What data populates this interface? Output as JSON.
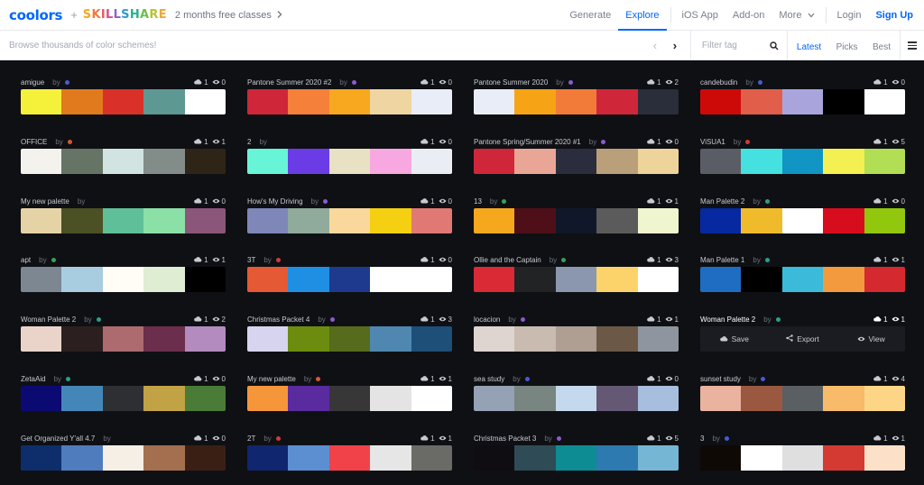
{
  "header": {
    "logo": "coolors",
    "plus": "+",
    "partner_parts": [
      {
        "text": "S",
        "color": "#f6a821"
      },
      {
        "text": "K",
        "color": "#f07b3f"
      },
      {
        "text": "I",
        "color": "#e85b5b"
      },
      {
        "text": "L",
        "color": "#d34f8a"
      },
      {
        "text": "L",
        "color": "#8a63c9"
      },
      {
        "text": "S",
        "color": "#2f9ad0"
      },
      {
        "text": "H",
        "color": "#23b38a"
      },
      {
        "text": "A",
        "color": "#6cbf45"
      },
      {
        "text": "R",
        "color": "#b7c330"
      },
      {
        "text": "E",
        "color": "#f0a73a"
      }
    ],
    "promo": "2 months free classes",
    "nav": {
      "generate": "Generate",
      "explore": "Explore",
      "ios": "iOS App",
      "addon": "Add-on",
      "more": "More",
      "login": "Login",
      "signup": "Sign Up"
    }
  },
  "search": {
    "placeholder": "Browse thousands of color schemes!",
    "filter_placeholder": "Filter tag",
    "tabs": [
      "Latest",
      "Picks",
      "Best"
    ],
    "active_tab": "Latest"
  },
  "colors": {
    "accent": "#0066ff",
    "background": "#0f1014"
  },
  "overlay": {
    "save": "Save",
    "export": "Export",
    "view": "View"
  },
  "palettes": [
    {
      "name": "amigue",
      "by": "by",
      "dot": "#4a5ad0",
      "saves": "1",
      "views": "0",
      "colors": [
        "#f5f03a",
        "#e17a1d",
        "#d9302a",
        "#5d9893",
        "#ffffff"
      ]
    },
    {
      "name": "Pantone Summer 2020 #2",
      "by": "by",
      "dot": "#8a5bd0",
      "saves": "1",
      "views": "0",
      "colors": [
        "#d0263a",
        "#f5803a",
        "#f8a81e",
        "#efd5a1",
        "#e8edf8"
      ]
    },
    {
      "name": "Pantone Summer 2020",
      "by": "by",
      "dot": "#8a5bd0",
      "saves": "1",
      "views": "2",
      "colors": [
        "#e8edf8",
        "#f7a316",
        "#f37b39",
        "#d0263a",
        "#2a2d3a"
      ]
    },
    {
      "name": "candebudin",
      "by": "by",
      "dot": "#4a5ad0",
      "saves": "1",
      "views": "0",
      "colors": [
        "#cd0a08",
        "#e05e4a",
        "#a9a5dc",
        "#000000",
        "#ffffff"
      ]
    },
    {
      "name": "OFFICE",
      "by": "by",
      "dot": "#d05a3a",
      "saves": "1",
      "views": "1",
      "colors": [
        "#f4f2ec",
        "#667466",
        "#d1e4e2",
        "#828c88",
        "#2f2516"
      ]
    },
    {
      "name": "2",
      "by": "by",
      "dot": "",
      "saves": "1",
      "views": "0",
      "colors": [
        "#68f5d7",
        "#6b3ce6",
        "#e8e1c4",
        "#f7a8e0",
        "#eaeef4"
      ]
    },
    {
      "name": "Pantone Spring/Summer 2020 #1",
      "by": "by",
      "dot": "#8a5bd0",
      "saves": "1",
      "views": "0",
      "colors": [
        "#d0263a",
        "#e9a697",
        "#2b2d3c",
        "#b99f7a",
        "#eed39b"
      ]
    },
    {
      "name": "ViSUA1",
      "by": "by",
      "dot": "#d03a3a",
      "saves": "1",
      "views": "5",
      "colors": [
        "#5b5d66",
        "#45e0e0",
        "#1095c5",
        "#f5f052",
        "#b1de54"
      ]
    },
    {
      "name": "My new palette",
      "by": "by",
      "dot": "",
      "saves": "1",
      "views": "0",
      "colors": [
        "#e6d3a5",
        "#4b5025",
        "#5fbf98",
        "#8be0a8",
        "#8b567a"
      ]
    },
    {
      "name": "How's My Driving",
      "by": "by",
      "dot": "#8a5bd0",
      "saves": "1",
      "views": "0",
      "colors": [
        "#7e87b8",
        "#90aa9c",
        "#fad89b",
        "#f5cf12",
        "#e07874"
      ]
    },
    {
      "name": "13",
      "by": "by",
      "dot": "#3aa05a",
      "saves": "1",
      "views": "1",
      "colors": [
        "#f5a81e",
        "#4e0f18",
        "#101728",
        "#5b5b5b",
        "#eff6cf"
      ]
    },
    {
      "name": "Man Palette 2",
      "by": "by",
      "dot": "#2aa08a",
      "saves": "1",
      "views": "0",
      "colors": [
        "#0629a1",
        "#f0bb2a",
        "#ffffff",
        "#d70d1d",
        "#91c70d"
      ]
    },
    {
      "name": "apt",
      "by": "by",
      "dot": "#3aa05a",
      "saves": "1",
      "views": "1",
      "colors": [
        "#7c8792",
        "#a8cde1",
        "#fffdf5",
        "#dfeed3",
        "#000000"
      ]
    },
    {
      "name": "3T",
      "by": "by",
      "dot": "#d03a3a",
      "saves": "1",
      "views": "0",
      "colors": [
        "#e55a35",
        "#1f8fe3",
        "#1d3a8e",
        "#ffffff",
        "#ffffff"
      ]
    },
    {
      "name": "Ollie and the Captain",
      "by": "by",
      "dot": "#3aa05a",
      "saves": "1",
      "views": "3",
      "colors": [
        "#da2a35",
        "#222325",
        "#8b97ae",
        "#fcd36a",
        "#ffffff"
      ]
    },
    {
      "name": "Man Palette 1",
      "by": "by",
      "dot": "#2aa08a",
      "saves": "1",
      "views": "1",
      "colors": [
        "#1f6dc2",
        "#000000",
        "#3bbad9",
        "#f29a3d",
        "#d42a2f"
      ]
    },
    {
      "name": "Woman Palette 2",
      "by": "by",
      "dot": "#2aa08a",
      "saves": "1",
      "views": "2",
      "colors": [
        "#ead4c9",
        "#2c1f20",
        "#ad6b70",
        "#6b2e4c",
        "#b38bbf"
      ]
    },
    {
      "name": "Christmas Packet 4",
      "by": "by",
      "dot": "#8a5bd0",
      "saves": "1",
      "views": "3",
      "colors": [
        "#d6d4ee",
        "#6b8c0f",
        "#566b1b",
        "#4f87b0",
        "#1d4f78"
      ]
    },
    {
      "name": "locacion",
      "by": "by",
      "dot": "#8a5bd0",
      "saves": "1",
      "views": "1",
      "colors": [
        "#ded5d0",
        "#c9bbb0",
        "#af9e92",
        "#6c5847",
        "#8e959f"
      ]
    },
    {
      "name": "Woman Palette 2",
      "by": "by",
      "dot": "#2aa08a",
      "saves": "1",
      "views": "1",
      "colors": [
        "#1a1c22",
        "#1a1c22",
        "#1a1c22",
        "#1a1c22",
        "#1a1c22"
      ],
      "highlight": true
    },
    {
      "name": "ZetaAid",
      "by": "by",
      "dot": "#2aa08a",
      "saves": "1",
      "views": "0",
      "colors": [
        "#0b0a72",
        "#4586b8",
        "#2e2f33",
        "#c1a245",
        "#4a7b37"
      ]
    },
    {
      "name": "My new palette",
      "by": "by",
      "dot": "#d05a3a",
      "saves": "1",
      "views": "1",
      "colors": [
        "#f6963a",
        "#5a2b9e",
        "#373738",
        "#e4e4e4",
        "#ffffff"
      ]
    },
    {
      "name": "sea study",
      "by": "by",
      "dot": "#4a5ad0",
      "saves": "1",
      "views": "0",
      "colors": [
        "#95a1b4",
        "#788580",
        "#c5d9ee",
        "#645875",
        "#a8bede"
      ]
    },
    {
      "name": "sunset study",
      "by": "by",
      "dot": "#4a5ad0",
      "saves": "1",
      "views": "4",
      "colors": [
        "#e9b3a0",
        "#9b5840",
        "#5a5f64",
        "#f7bb6a",
        "#fdd586"
      ]
    },
    {
      "name": "Get Organized Y'all 4.7",
      "by": "by",
      "dot": "",
      "saves": "1",
      "views": "0",
      "colors": [
        "#0e2e6b",
        "#4e7cbd",
        "#f6efe6",
        "#a36f4f",
        "#3a1f14"
      ]
    },
    {
      "name": "2T",
      "by": "by",
      "dot": "#d03a3a",
      "saves": "1",
      "views": "1",
      "colors": [
        "#10266e",
        "#5b8fd1",
        "#f1424a",
        "#e6e6e6",
        "#6a6a66"
      ]
    },
    {
      "name": "Christmas Packet 3",
      "by": "by",
      "dot": "#8a5bd0",
      "saves": "1",
      "views": "5",
      "colors": [
        "#0f0d12",
        "#2f4b55",
        "#0e8c94",
        "#2c7ab0",
        "#75b6d4"
      ]
    },
    {
      "name": "3",
      "by": "by",
      "dot": "#4a5ad0",
      "saves": "1",
      "views": "1",
      "colors": [
        "#0f0906",
        "#ffffff",
        "#dfdfdf",
        "#d43a32",
        "#fde0c8"
      ]
    }
  ]
}
